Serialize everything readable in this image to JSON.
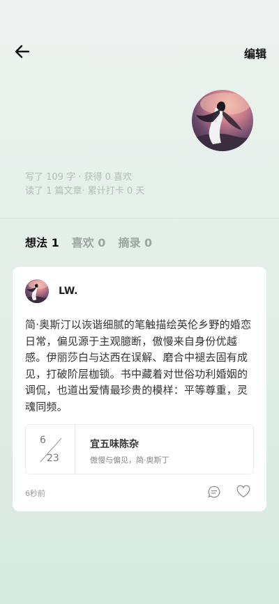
{
  "header": {
    "edit_label": "编辑"
  },
  "profile": {
    "stats_line1": "写了 109 字 · 获得 0 喜欢",
    "stats_line2": "读了 1 篇文章· 累计打卡 0 天"
  },
  "tabs": [
    {
      "label": "想法 1",
      "active": true
    },
    {
      "label": "喜欢 0",
      "active": false
    },
    {
      "label": "摘录 0",
      "active": false
    }
  ],
  "post": {
    "author": "LW.",
    "content": "简·奥斯汀以诙谐细腻的笔触描绘英伦乡野的婚恋日常，偏见源于主观臆断，傲慢来自身份优越感。伊丽莎白与达西在误解、磨合中褪去固有成见，打破阶层枷锁。书中藏着对世俗功利婚姻的调侃，也道出爱情最珍贵的模样：平等尊重，灵魂同频。",
    "quote": {
      "month": "6",
      "day": "23",
      "title": "宜五味陈杂",
      "subtitle": "傲慢与偏见，简·奥斯丁"
    },
    "time": "6秒前"
  },
  "icons": {
    "back": "back-arrow-icon",
    "comment": "comment-icon",
    "like": "heart-icon"
  }
}
